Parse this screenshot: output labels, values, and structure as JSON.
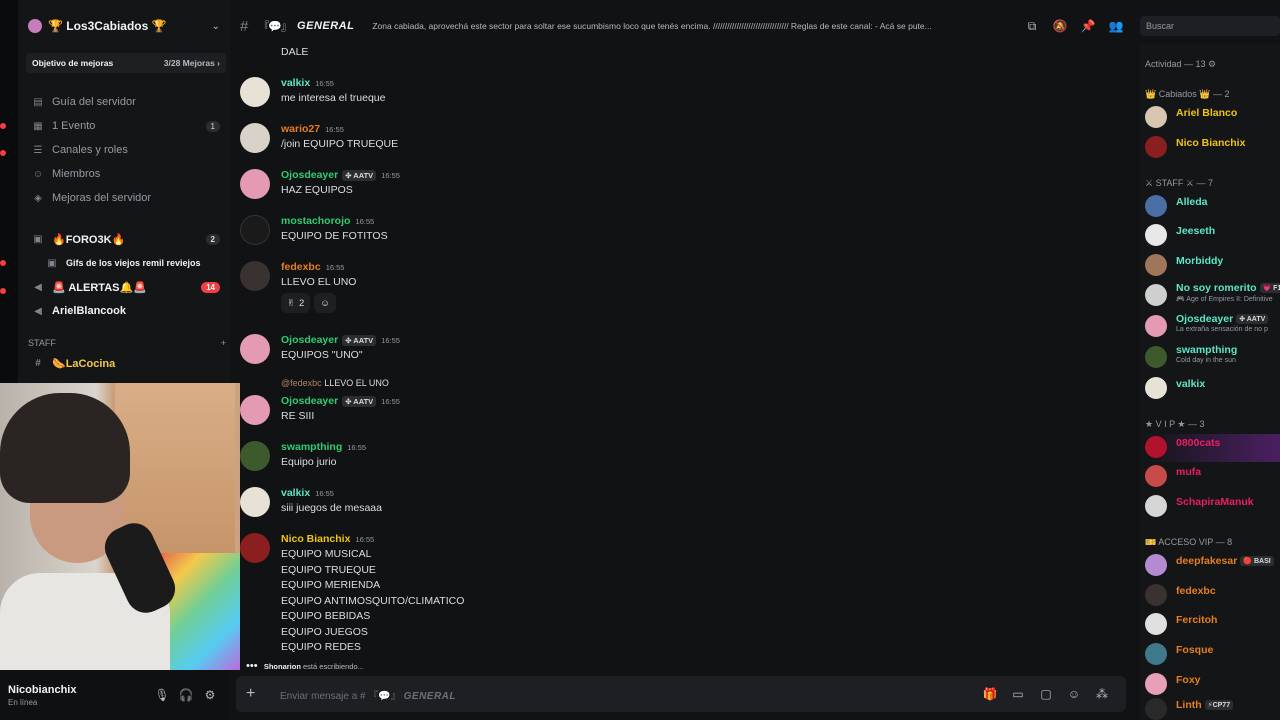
{
  "guild": {
    "name": "🏆 Los3Cabiados 🏆",
    "boost_label": "Objetivo de mejoras",
    "boost_progress": "3/28 Mejoras"
  },
  "sidebar": {
    "items": [
      {
        "icon": "guide-icon",
        "label": "Guía del servidor",
        "count": ""
      },
      {
        "icon": "calendar-icon",
        "label": "1 Evento",
        "count": "1"
      },
      {
        "icon": "channels-icon",
        "label": "Canales y roles",
        "count": ""
      },
      {
        "icon": "members-icon",
        "label": "Miembros",
        "count": ""
      },
      {
        "icon": "boost-icon",
        "label": "Mejoras del servidor",
        "count": ""
      },
      {
        "icon": "forum-icon",
        "label": "🔥FORO3K🔥",
        "count": "2"
      },
      {
        "icon": "thread-icon",
        "label": "Gifs de los viejos remil reviejos",
        "count": ""
      },
      {
        "icon": "megaphone-icon",
        "label": "🚨 ALERTAS🔔🚨",
        "count": "14"
      },
      {
        "icon": "megaphone-icon",
        "label": "ArielBlancook",
        "count": ""
      }
    ],
    "category": "STAFF",
    "staff_channel": "🌭LaCocina"
  },
  "user_panel": {
    "username": "Nicobianchix",
    "status": "En línea"
  },
  "channel": {
    "emoji": "『💬』",
    "name": "GENERAL",
    "topic": "Zona cabiada, aprovechá este sector para soltar ese sucumbismo loco que tenés encima. //////////////////////////////// Reglas de este canal: - Acá se pute..."
  },
  "search": {
    "placeholder": "Buscar"
  },
  "messages": [
    {
      "text_only": true,
      "text": "DALE"
    },
    {
      "author": "valkix",
      "color": "#5ce6c8",
      "time": "16:55",
      "tag": "",
      "lines": [
        "me interesa el trueque"
      ]
    },
    {
      "author": "wario27",
      "color": "#e67e22",
      "time": "16:55",
      "tag": "",
      "lines": [
        "/join EQUIPO TRUEQUE"
      ]
    },
    {
      "author": "Ojosdeayer",
      "color": "#2ecc71",
      "time": "16:55",
      "tag": "✤ AATV",
      "lines": [
        "HAZ EQUIPOS"
      ]
    },
    {
      "author": "mostachorojo",
      "color": "#2ecc71",
      "time": "16:55",
      "tag": "",
      "lines": [
        "EQUIPO DE FOTITOS"
      ]
    },
    {
      "author": "fedexbc",
      "color": "#e67e22",
      "time": "16:55",
      "tag": "",
      "lines": [
        "LLEVO EL UNO"
      ],
      "reaction": {
        "emoji": "✌",
        "count": "2"
      }
    },
    {
      "author": "Ojosdeayer",
      "color": "#2ecc71",
      "time": "16:55",
      "tag": "✤ AATV",
      "lines": [
        "EQUIPOS \"UNO\""
      ]
    },
    {
      "author": "Ojosdeayer",
      "color": "#2ecc71",
      "time": "16:55",
      "tag": "✤ AATV",
      "lines": [
        "RE SIII"
      ],
      "reply": {
        "name": "@fedexbc",
        "text": "LLEVO EL UNO"
      }
    },
    {
      "author": "swampthing",
      "color": "#2ecc71",
      "time": "16:55",
      "tag": "",
      "lines": [
        "Equipo jurio"
      ]
    },
    {
      "author": "valkix",
      "color": "#5ce6c8",
      "time": "16:55",
      "tag": "",
      "lines": [
        "siii juegos de mesaaa"
      ]
    },
    {
      "author": "Nico Bianchix",
      "color": "#f1c40f",
      "time": "16:55",
      "tag": "",
      "lines": [
        "EQUIPO MUSICAL",
        "EQUIPO TRUEQUE",
        "EQUIPO MERIENDA",
        "EQUIPO ANTIMOSQUITO/CLIMATICO",
        "EQUIPO BEBIDAS",
        "EQUIPO JUEGOS",
        "EQUIPO REDES"
      ]
    }
  ],
  "typing": {
    "name": "Shonarion",
    "text": "está escribiendo..."
  },
  "composer": {
    "prefix": "Enviar mensaje a # 『💬』",
    "channel": "GENERAL"
  },
  "members": {
    "activity": "Actividad — 13 ⚙",
    "groups": [
      {
        "title": "👑 Cabiados 👑 — 2",
        "people": [
          {
            "name": "Ariel Blanco",
            "color": "#f1c40f",
            "sub": "",
            "tag": ""
          },
          {
            "name": "Nico Bianchix",
            "color": "#f1c40f",
            "sub": "",
            "tag": ""
          }
        ]
      },
      {
        "title": "⚔ STAFF ⚔ — 7",
        "people": [
          {
            "name": "Alleda",
            "color": "#5ce6c8",
            "sub": "",
            "tag": ""
          },
          {
            "name": "Jeeseth",
            "color": "#5ce6c8",
            "sub": "",
            "tag": ""
          },
          {
            "name": "Morbiddy",
            "color": "#5ce6c8",
            "sub": "",
            "tag": ""
          },
          {
            "name": "No soy romerito",
            "color": "#5ce6c8",
            "sub": "🎮 Age of Empires II: Definitive",
            "tag": "💗 F1"
          },
          {
            "name": "Ojosdeayer",
            "color": "#5ce6c8",
            "sub": "La extraña sensación de no p",
            "tag": "✤ AATV"
          },
          {
            "name": "swampthing",
            "color": "#5ce6c8",
            "sub": "Cold day in the sun",
            "tag": ""
          },
          {
            "name": "valkix",
            "color": "#5ce6c8",
            "sub": "",
            "tag": ""
          }
        ]
      },
      {
        "title": "★ V I P ★ — 3",
        "people": [
          {
            "name": "0800cats",
            "color": "#e91e63",
            "sub": "",
            "tag": ""
          },
          {
            "name": "mufa",
            "color": "#e91e63",
            "sub": "",
            "tag": ""
          },
          {
            "name": "SchapiraManuk",
            "color": "#e91e63",
            "sub": "",
            "tag": ""
          }
        ]
      },
      {
        "title": "🎫 ACCESO VIP — 8",
        "people": [
          {
            "name": "deepfakesar",
            "color": "#e67e22",
            "sub": "",
            "tag": "🔴 BASI"
          },
          {
            "name": "fedexbc",
            "color": "#e67e22",
            "sub": "",
            "tag": ""
          },
          {
            "name": "Fercitoh",
            "color": "#e67e22",
            "sub": "",
            "tag": ""
          },
          {
            "name": "Fosque",
            "color": "#e67e22",
            "sub": "",
            "tag": ""
          },
          {
            "name": "Foxy",
            "color": "#e67e22",
            "sub": "",
            "tag": ""
          },
          {
            "name": "Linth",
            "color": "#e67e22",
            "sub": "",
            "tag": "⚡CP77"
          }
        ]
      }
    ]
  },
  "colors": {
    "background": "#111214",
    "sidebar": "#141517",
    "composer": "#1e1f22",
    "accent_red": "#f23f43"
  }
}
